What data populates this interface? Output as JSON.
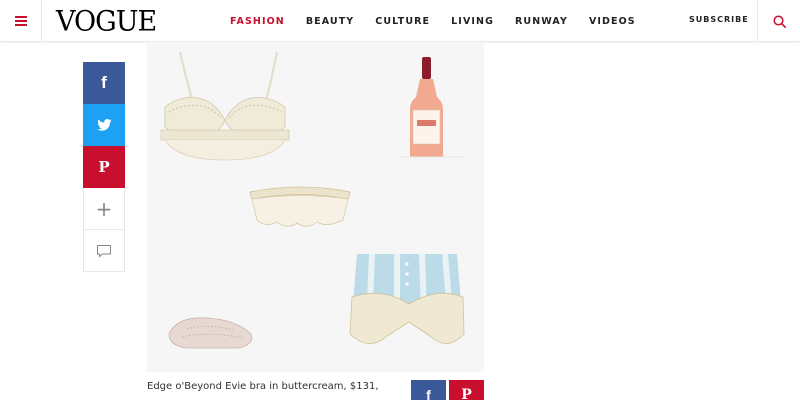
{
  "header": {
    "logo": "VOGUE",
    "nav": [
      "FASHION",
      "BEAUTY",
      "CULTURE",
      "LIVING",
      "RUNWAY",
      "VIDEOS"
    ],
    "active_nav": "FASHION",
    "subscribe": "SUBSCRIBE"
  },
  "share_rail": {
    "facebook_glyph": "f",
    "pinterest_glyph": "P",
    "more_glyph": "+"
  },
  "caption": "Edge o'Beyond Evie bra in buttercream, $131,",
  "mini_share": {
    "facebook_glyph": "f",
    "pinterest_glyph": "P"
  },
  "colors": {
    "brand_red": "#c8102e",
    "facebook": "#3b5998",
    "twitter": "#1da1f2"
  }
}
